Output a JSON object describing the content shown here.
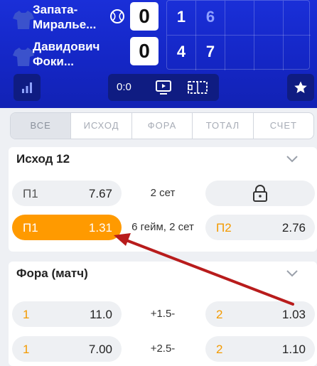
{
  "match": {
    "player1": {
      "name": "Запата-Миралье...",
      "score": "0",
      "sets": [
        "1",
        "6"
      ]
    },
    "player2": {
      "name": "Давидович Фоки...",
      "score": "0",
      "sets": [
        "4",
        "7"
      ]
    },
    "control_score": "0:0"
  },
  "tabs": [
    {
      "label": "ВСЕ",
      "active": true
    },
    {
      "label": "ИСХОД",
      "active": false
    },
    {
      "label": "ФОРА",
      "active": false
    },
    {
      "label": "ТОТАЛ",
      "active": false
    },
    {
      "label": "СЧЕТ",
      "active": false
    }
  ],
  "markets": [
    {
      "title": "Исход 12",
      "rows": [
        {
          "left_label": "П1",
          "left_value": "7.67",
          "middle": "2 сет",
          "right_label": "",
          "right_value": "",
          "right_locked": true,
          "left_selected": false
        },
        {
          "left_label": "П1",
          "left_value": "1.31",
          "middle": "6 гейм, 2 сет",
          "right_label": "П2",
          "right_value": "2.76",
          "right_locked": false,
          "left_selected": true
        }
      ]
    },
    {
      "title": "Фора (матч)",
      "rows": [
        {
          "left_label": "1",
          "left_value": "11.0",
          "middle": "+1.5-",
          "right_label": "2",
          "right_value": "1.03"
        },
        {
          "left_label": "1",
          "left_value": "7.00",
          "middle": "+2.5-",
          "right_label": "2",
          "right_value": "1.10"
        }
      ]
    }
  ],
  "icons": {
    "ball": "tennis-ball-icon",
    "stats": "stats-bars-icon",
    "tv": "tv-play-icon",
    "field": "field-icon",
    "favorite": "star-icon",
    "lock": "lock-icon",
    "chevron": "chevron-down-icon"
  },
  "colors": {
    "header_blue": "#1a2fd8",
    "header_dark": "#0f1c82",
    "selected_orange": "#ff9a00",
    "annotation_arrow": "#b81c1c"
  }
}
